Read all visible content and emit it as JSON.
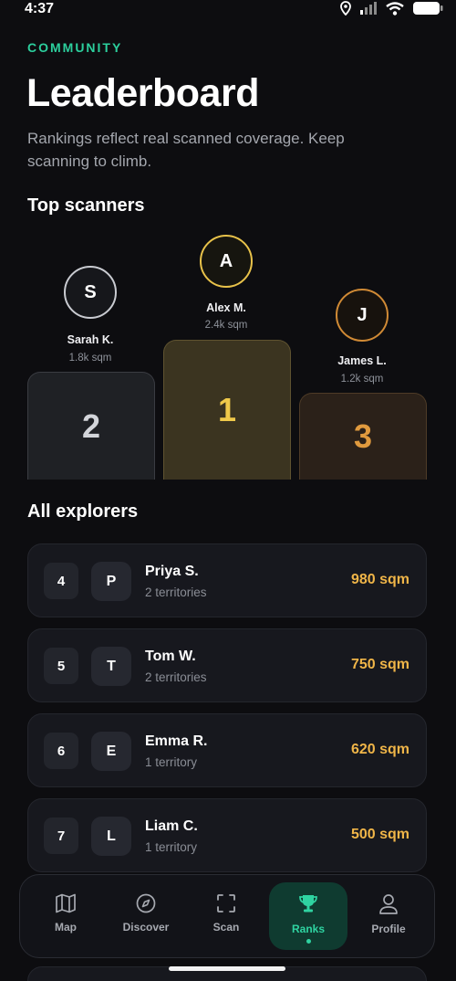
{
  "status": {
    "time": "4:37"
  },
  "header": {
    "eyebrow": "COMMUNITY",
    "title": "Leaderboard",
    "subtitle": "Rankings reflect real scanned coverage. Keep scanning to climb."
  },
  "top_section": {
    "title": "Top scanners",
    "podium": [
      {
        "rank": "2",
        "initial": "S",
        "name": "Sarah K.",
        "sqm": "1.8k sqm"
      },
      {
        "rank": "1",
        "initial": "A",
        "name": "Alex M.",
        "sqm": "2.4k sqm"
      },
      {
        "rank": "3",
        "initial": "J",
        "name": "James L.",
        "sqm": "1.2k sqm"
      }
    ]
  },
  "all_section": {
    "title": "All explorers",
    "rows": [
      {
        "rank": "4",
        "initial": "P",
        "name": "Priya S.",
        "territories": "2 territories",
        "sqm": "980 sqm"
      },
      {
        "rank": "5",
        "initial": "T",
        "name": "Tom W.",
        "territories": "2 territories",
        "sqm": "750 sqm"
      },
      {
        "rank": "6",
        "initial": "E",
        "name": "Emma R.",
        "territories": "1 territory",
        "sqm": "620 sqm"
      },
      {
        "rank": "7",
        "initial": "L",
        "name": "Liam C.",
        "territories": "1 territory",
        "sqm": "500 sqm"
      }
    ]
  },
  "nav": {
    "items": [
      {
        "label": "Map",
        "icon": "map-icon"
      },
      {
        "label": "Discover",
        "icon": "compass-icon"
      },
      {
        "label": "Scan",
        "icon": "scan-icon"
      },
      {
        "label": "Ranks",
        "icon": "trophy-icon",
        "active": true
      },
      {
        "label": "Profile",
        "icon": "profile-icon"
      }
    ]
  },
  "colors": {
    "accent": "#2ccf9d",
    "gold": "#e8c24a",
    "bronze": "#d08a35",
    "silver": "#c9cbd1",
    "sqm": "#f0b548"
  }
}
